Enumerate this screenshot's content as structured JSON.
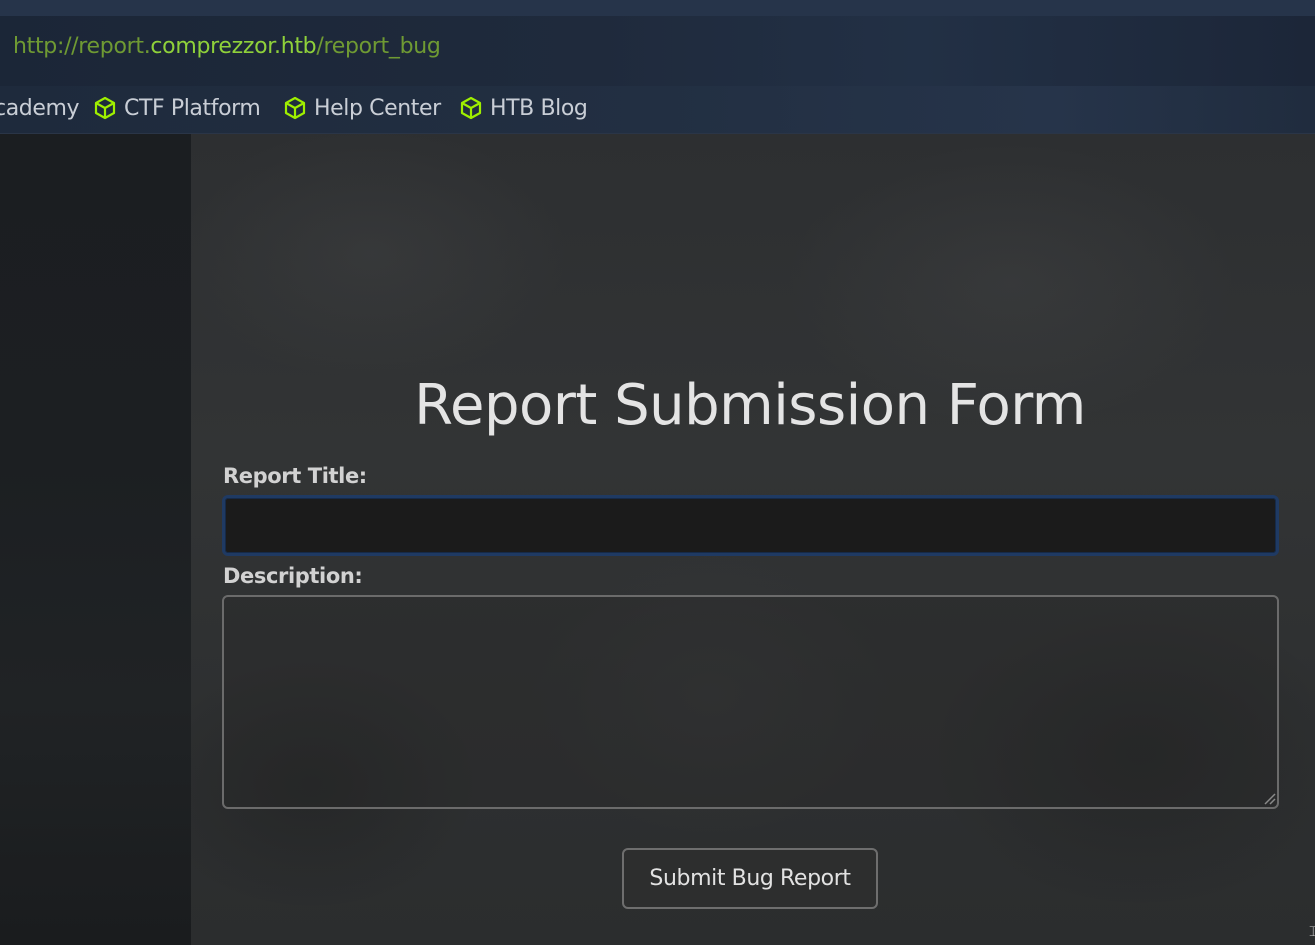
{
  "browser": {
    "url": {
      "scheme_prefix": "http://report.",
      "domain": "comprezzor.htb",
      "path": "/report_bug"
    },
    "bookmarks": [
      {
        "label": "cademy",
        "icon": "cube-icon"
      },
      {
        "label": "CTF Platform",
        "icon": "cube-icon"
      },
      {
        "label": "Help Center",
        "icon": "cube-icon"
      },
      {
        "label": "HTB Blog",
        "icon": "cube-icon"
      }
    ],
    "colors": {
      "url_dim": "#6f9a33",
      "url_bright": "#8fd13a",
      "bookmark_icon": "#9fef00"
    }
  },
  "form": {
    "heading": "Report Submission Form",
    "title_label": "Report Title:",
    "title_value": "",
    "description_label": "Description:",
    "description_value": "",
    "submit_label": "Submit Bug Report"
  }
}
